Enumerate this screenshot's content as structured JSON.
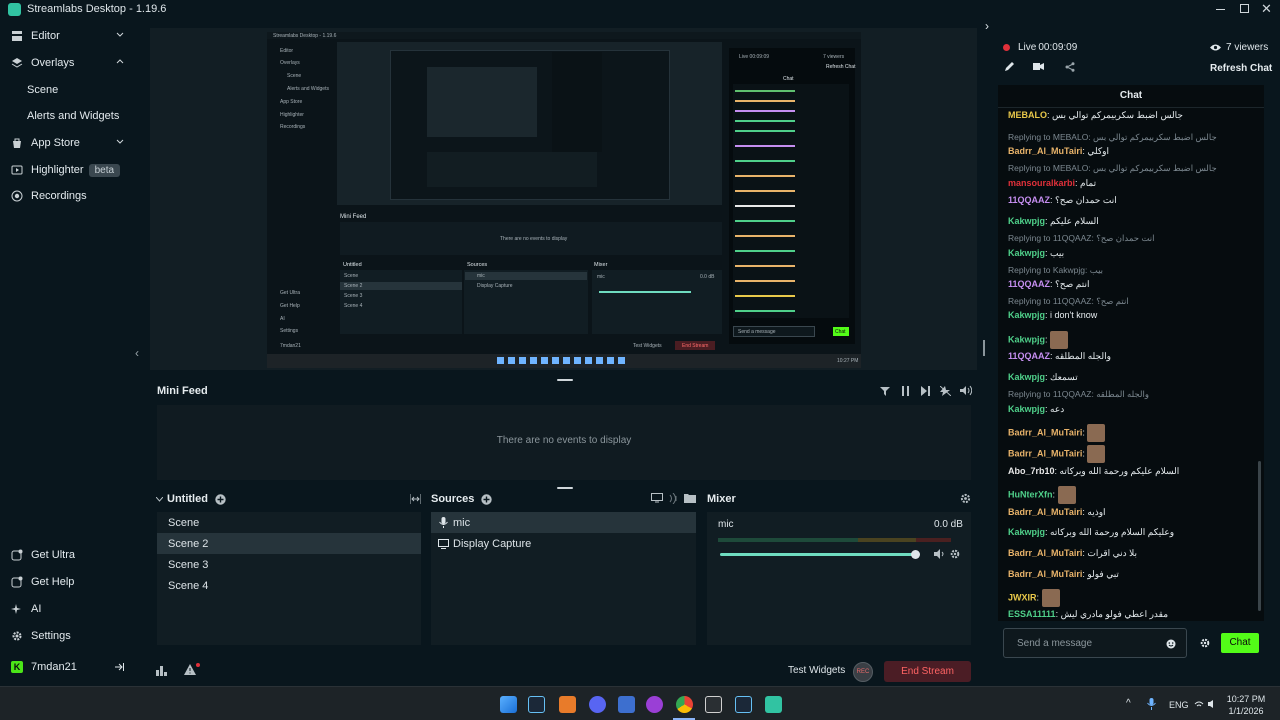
{
  "window": {
    "title": "Streamlabs Desktop - 1.19.6"
  },
  "sidebar": {
    "items": [
      {
        "label": "Editor",
        "icon": "editor-icon"
      },
      {
        "label": "Overlays",
        "icon": "overlays-icon"
      },
      {
        "label": "Scene"
      },
      {
        "label": "Alerts and Widgets"
      },
      {
        "label": "App Store",
        "icon": "app-store-icon"
      },
      {
        "label": "Highlighter",
        "icon": "highlighter-icon",
        "badge": "beta"
      },
      {
        "label": "Recordings",
        "icon": "recordings-icon"
      }
    ],
    "bottom": [
      {
        "label": "Get Ultra",
        "icon": "ultra-icon"
      },
      {
        "label": "Get Help",
        "icon": "help-icon"
      },
      {
        "label": "AI",
        "icon": "ai-icon"
      },
      {
        "label": "Settings",
        "icon": "gear-icon"
      }
    ],
    "user": "7mdan21"
  },
  "preview": {
    "inner_title": "Streamlabs Desktop - 1.19.6",
    "inner_minifeed": "Mini Feed",
    "inner_no_events": "There are no events to display",
    "inner_scenes_title": "Untitled",
    "inner_sources_title": "Sources",
    "inner_mixer_title": "Mixer",
    "inner_scenes": [
      "Scene",
      "Scene 2",
      "Scene 3",
      "Scene 4"
    ],
    "inner_sources": [
      "mic",
      "Display Capture"
    ],
    "inner_mic": "mic",
    "inner_db": "0.0 dB",
    "inner_test_widgets": "Test Widgets",
    "inner_end_stream": "End Stream",
    "inner_live": "Live 00:09:09",
    "inner_viewers": "7 viewers",
    "inner_refresh": "Refresh Chat",
    "inner_chat": "Chat",
    "inner_send": "Send a message",
    "inner_chat_btn": "Chat",
    "inner_side": [
      "Editor",
      "Overlays",
      "Scene",
      "Alerts and Widgets",
      "App Store",
      "Highlighter",
      "Recordings"
    ],
    "inner_side_bottom": [
      "Get Ultra",
      "Get Help",
      "AI",
      "Settings",
      "7mdan21"
    ],
    "inner_time": "10:27 PM"
  },
  "minifeed": {
    "title": "Mini Feed",
    "empty": "There are no events to display"
  },
  "scenes": {
    "title": "Untitled",
    "items": [
      "Scene",
      "Scene 2",
      "Scene 3",
      "Scene 4"
    ],
    "selected": 1
  },
  "sources": {
    "title": "Sources",
    "items": [
      {
        "label": "mic",
        "icon": "mic-icon"
      },
      {
        "label": "Display Capture",
        "icon": "monitor-icon"
      }
    ]
  },
  "mixer": {
    "title": "Mixer",
    "channel": "mic",
    "db": "0.0 dB",
    "volume": 1.0
  },
  "footer": {
    "test_widgets": "Test Widgets",
    "rec": "REC",
    "end_stream": "End Stream"
  },
  "chat": {
    "live": "Live",
    "time": "00:09:09",
    "viewers": "7 viewers",
    "refresh": "Refresh Chat",
    "title": "Chat",
    "placeholder": "Send a message",
    "send": "Chat",
    "messages": [
      {
        "user": "MEBALO",
        "text": "جالس اضبط سكربيمركم توالي بس",
        "color": "#e8c84a"
      },
      {
        "reply": "Replying to MEBALO: جالس اضبط سكربيمركم توالي بس"
      },
      {
        "user": "Badrr_Al_MuTairi",
        "text": "اوكلي",
        "color": "#e8b36a"
      },
      {
        "reply": "Replying to MEBALO: جالس اضبط سكربيمركم توالي بس"
      },
      {
        "user": "mansouralkarbi",
        "text": "تمام",
        "color": "#e0303a"
      },
      {
        "user": "11QQAAZ",
        "text": "انت حمدان صح؟",
        "color": "#c58ef0"
      },
      {
        "user": "Kakwpjg",
        "text": "السلام عليكم",
        "color": "#4fd08a"
      },
      {
        "reply": "Replying to 11QQAAZ: انت حمدان صح؟"
      },
      {
        "user": "Kakwpjg",
        "text": "بيب",
        "color": "#4fd08a"
      },
      {
        "reply": "Replying to Kakwpjg: بيب"
      },
      {
        "user": "11QQAAZ",
        "text": "انتم صح؟",
        "color": "#c58ef0"
      },
      {
        "reply": "Replying to 11QQAAZ: انتم صح؟"
      },
      {
        "user": "Kakwpjg",
        "text": "i don't know",
        "color": "#4fd08a"
      },
      {
        "user": "Kakwpjg",
        "text": "",
        "color": "#4fd08a",
        "emote": true
      },
      {
        "user": "11QQAAZ",
        "text": "والجله المطلقه",
        "color": "#c58ef0"
      },
      {
        "user": "Kakwpjg",
        "text": "تسمعك",
        "color": "#4fd08a"
      },
      {
        "reply": "Replying to 11QQAAZ: والجله المطلقه"
      },
      {
        "user": "Kakwpjg",
        "text": "دعه",
        "color": "#4fd08a"
      },
      {
        "user": "Badrr_Al_MuTairi",
        "text": "",
        "color": "#e8b36a",
        "emote": true
      },
      {
        "user": "Badrr_Al_MuTairi",
        "text": "",
        "color": "#e8b36a",
        "emote": true
      },
      {
        "user": "Abo_7rb10",
        "text": "السلام عليكم ورحمة الله وبركاته",
        "color": "#e8e8e8"
      },
      {
        "user": "HuNterXfn",
        "text": "",
        "color": "#4fd08a",
        "emote": true
      },
      {
        "user": "Badrr_Al_MuTairi",
        "text": "اوذيه",
        "color": "#e8b36a"
      },
      {
        "user": "Kakwpjg",
        "text": "وعليكم السلام ورحمة الله وبركاته",
        "color": "#4fd08a"
      },
      {
        "user": "Badrr_Al_MuTairi",
        "text": "بلا دني اقرات",
        "color": "#e8b36a"
      },
      {
        "user": "Badrr_Al_MuTairi",
        "text": "تبي فولو",
        "color": "#e8b36a"
      },
      {
        "user": "JWXIR",
        "text": "",
        "color": "#e8c84a",
        "emote": true
      },
      {
        "user": "ESSA11111",
        "text": "مقدر اعطي فولو مادري ليش",
        "color": "#4fd08a"
      }
    ]
  },
  "taskbar": {
    "lang": "ENG",
    "time": "10:27 PM",
    "date": "1/1/2026"
  }
}
